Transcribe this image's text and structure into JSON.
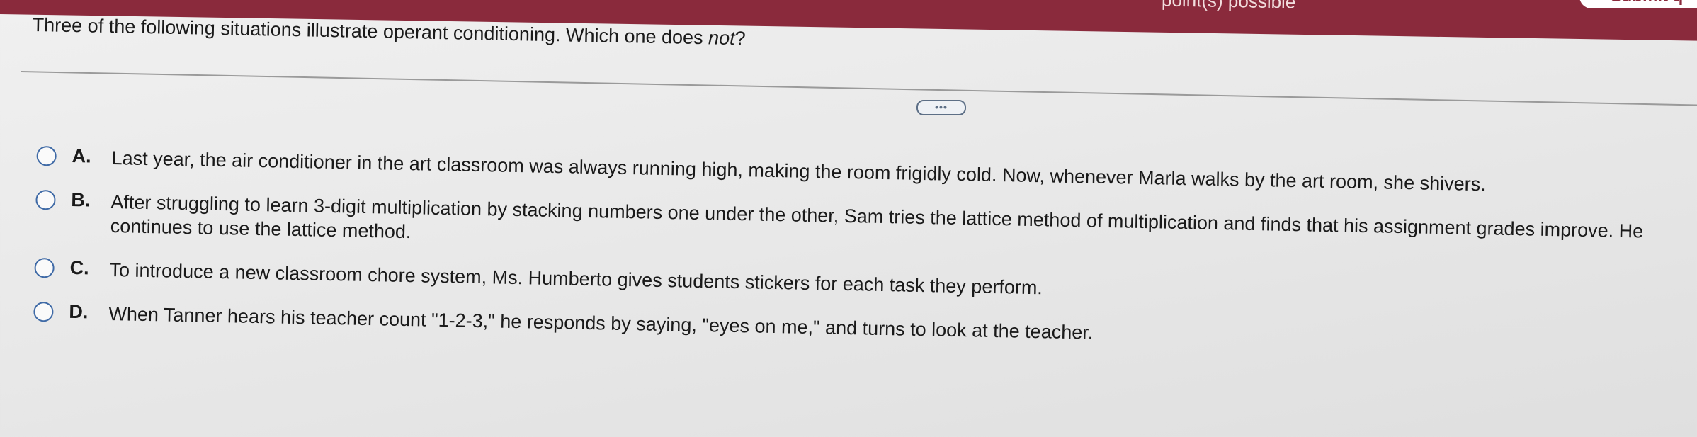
{
  "header": {
    "points_text": "point(s) possible",
    "submit_label": "Submit q"
  },
  "question": {
    "prefix": "Three of the following situations illustrate operant conditioning. Which one does ",
    "emphasis": "not",
    "suffix": "?"
  },
  "more_button": {
    "label": "•••"
  },
  "options": [
    {
      "letter": "A.",
      "text": "Last year, the air conditioner in the art classroom was always running high, making the room frigidly cold. Now, whenever Marla walks by the art room, she shivers."
    },
    {
      "letter": "B.",
      "text": "After struggling to learn 3-digit multiplication by stacking numbers one under the other, Sam tries the lattice method of multiplication and finds that his assignment grades improve. He continues to use the lattice method."
    },
    {
      "letter": "C.",
      "text": "To introduce a new classroom chore system, Ms. Humberto gives students stickers for each task they perform."
    },
    {
      "letter": "D.",
      "text": "When Tanner hears his teacher count \"1-2-3,\" he responds by saying, \"eyes on me,\" and turns to look at the teacher."
    }
  ]
}
